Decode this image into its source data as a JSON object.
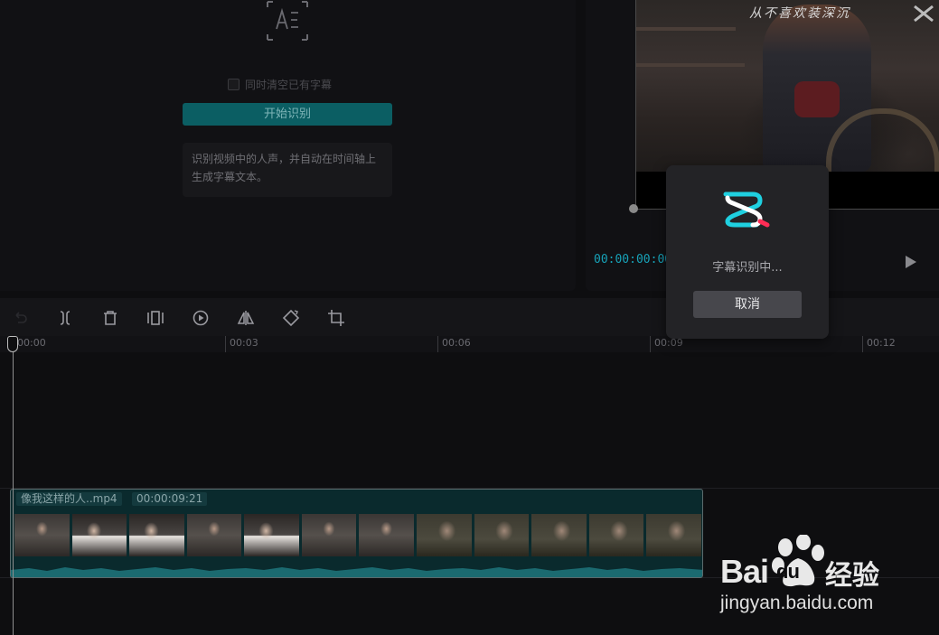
{
  "recognition_panel": {
    "clear_existing_label": "同时清空已有字幕",
    "start_button": "开始识别",
    "description_line1": "识别视频中的人声，并自动在时间轴上",
    "description_line2": "生成字幕文本。"
  },
  "player": {
    "watermark_text": "从不喜欢装深沉",
    "timecode": "00:00:00:00"
  },
  "ruler": {
    "ticks": [
      "00:00",
      "00:03",
      "00:06",
      "00:09",
      "00:12"
    ]
  },
  "clip": {
    "filename": "像我这样的人..mp4",
    "duration": "00:00:09:21"
  },
  "modal": {
    "status_text": "字幕识别中...",
    "cancel_label": "取消"
  },
  "baidu": {
    "word": "Bai",
    "du": "du",
    "brand": "经验",
    "url": "jingyan.baidu.com"
  },
  "colors": {
    "accent": "#17a2b8",
    "start_button": "#0b5e63",
    "clip_bg": "#0a2a2d"
  }
}
